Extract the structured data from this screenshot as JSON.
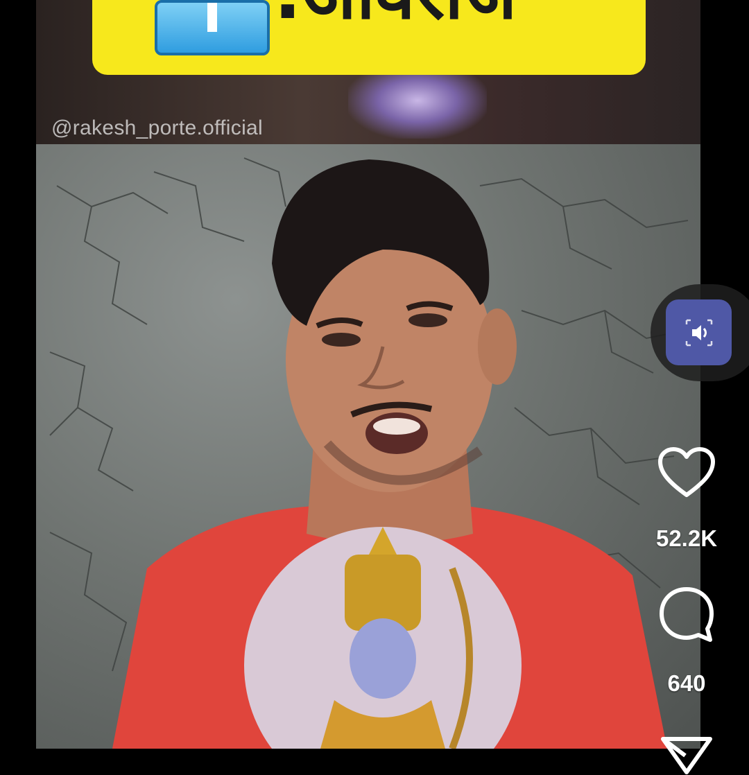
{
  "banner": {
    "text": ".ओवरोज",
    "background": "#f7e81c",
    "icon": "info-tile-icon"
  },
  "video": {
    "watermark": "@rakesh_porte.official"
  },
  "actions": {
    "mute_toggle": {
      "icon": "speaker-icon",
      "color": "#4f58a6"
    },
    "like": {
      "icon": "heart-icon",
      "count": "52.2K"
    },
    "comment": {
      "icon": "comment-bubble-icon",
      "count": "640"
    },
    "share": {
      "icon": "send-icon"
    }
  }
}
